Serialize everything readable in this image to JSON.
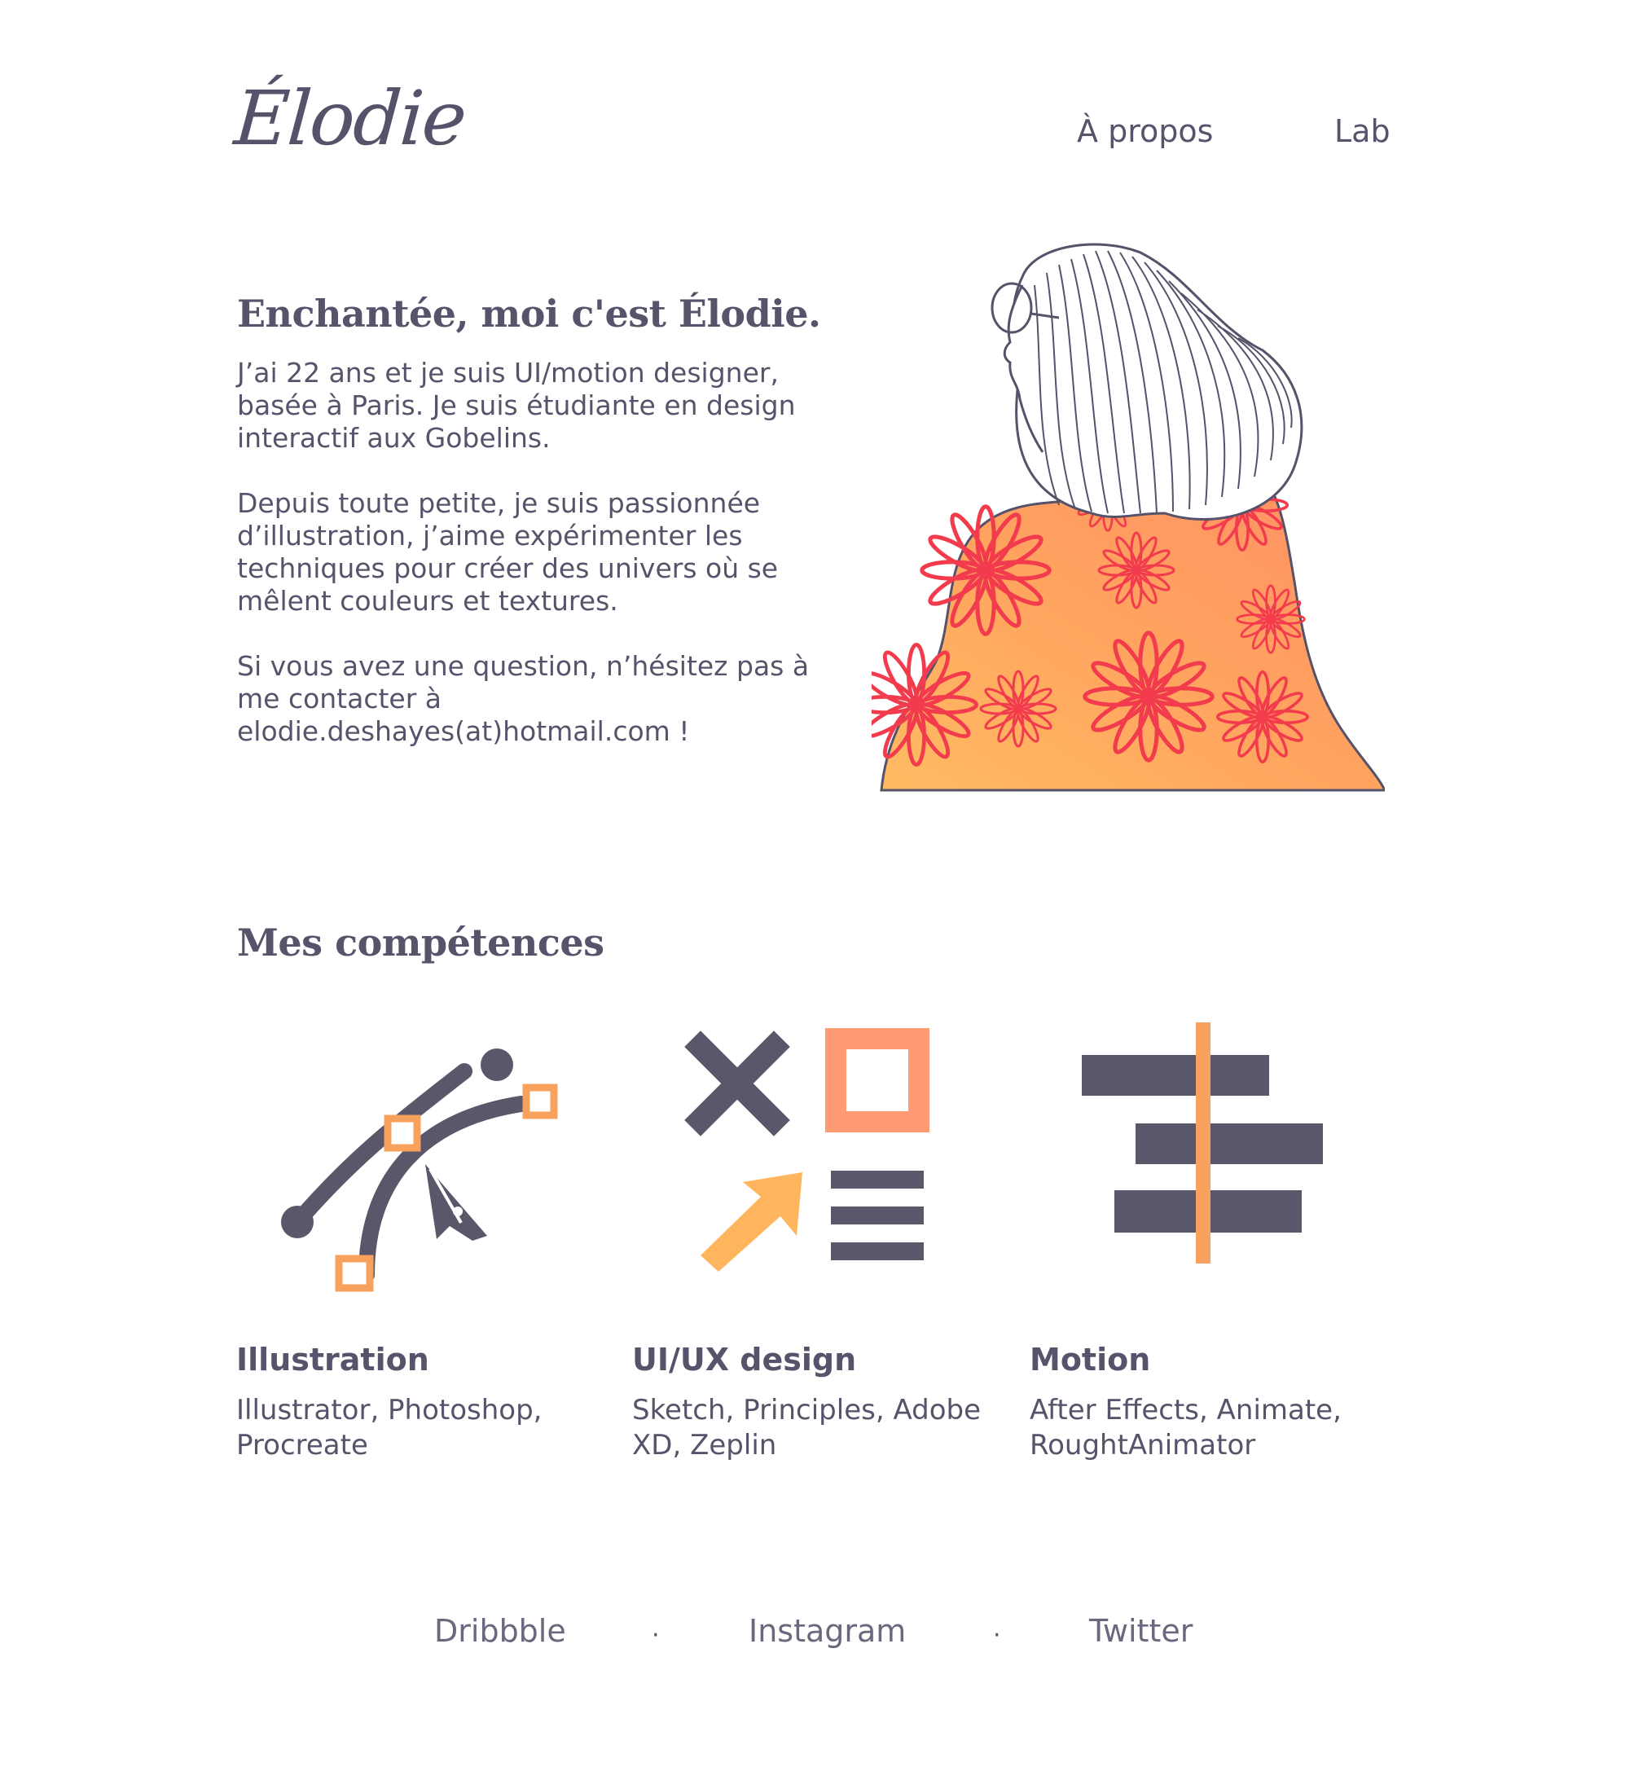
{
  "header": {
    "logo": "Élodie",
    "nav": [
      {
        "label": "À propos"
      },
      {
        "label": "Lab"
      }
    ]
  },
  "intro": {
    "title": "Enchantée, moi c'est Élodie.",
    "p1_before": "J’ai 22 ans et je suis UI/motion designer, basée à Paris. Je suis étudiante en design interactif aux ",
    "p1_link": "Gobelins.",
    "p2": "Depuis toute petite, je suis passionnée d’illustration, j’aime expérimenter les techniques pour créer des univers où se mêlent couleurs et textures.",
    "p3": "Si vous avez une question, n’hésitez pas à me contacter à elodie.deshayes(at)hotmail.com !"
  },
  "skills": {
    "title": "Mes compétences",
    "items": [
      {
        "name": "Illustration",
        "tools": "Illustrator, Photoshop, Procreate",
        "icon": "bezier-pen-icon"
      },
      {
        "name": "UI/UX design",
        "tools": "Sketch, Principles, Adobe XD, Zeplin",
        "icon": "ui-elements-icon"
      },
      {
        "name": "Motion",
        "tools": "After Effects, Animate, RoughtAnimator",
        "icon": "timeline-icon"
      }
    ]
  },
  "footer": {
    "links": [
      "Dribbble",
      "Instagram",
      "Twitter"
    ],
    "separator": "·"
  },
  "colors": {
    "text": "#56536a",
    "accent_orange": "#ffa95a",
    "accent_salmon": "#f79a84",
    "flower_red": "#f23c4e"
  }
}
